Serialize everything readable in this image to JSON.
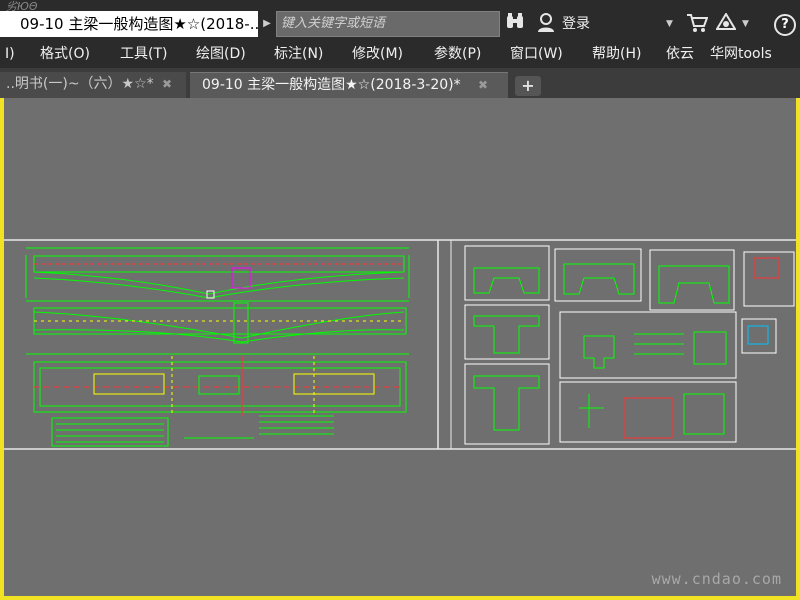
{
  "titlebar": {
    "app_glyph": "劣ЮΘ",
    "document_title": "09-10 主梁一般构造图★☆(2018-...",
    "search_placeholder": "键入关键字或短语",
    "login_label": "登录",
    "help_label": "?",
    "icons": [
      "binoculars-icon",
      "user-icon",
      "cart-icon",
      "a360-icon",
      "help-icon"
    ]
  },
  "menu": {
    "items": [
      {
        "label": "I)"
      },
      {
        "label": "格式(O)"
      },
      {
        "label": "工具(T)"
      },
      {
        "label": "绘图(D)"
      },
      {
        "label": "标注(N)"
      },
      {
        "label": "修改(M)"
      },
      {
        "label": "参数(P)"
      },
      {
        "label": "窗口(W)"
      },
      {
        "label": "帮助(H)"
      },
      {
        "label": "依云"
      },
      {
        "label": "华网tools"
      }
    ]
  },
  "tabs": [
    {
      "label": "..明书(一)~（六）★☆*",
      "active": false
    },
    {
      "label": "09-10 主梁一般构造图★☆(2018-3-20)*",
      "active": true
    }
  ],
  "tab_close_glyph": "✖",
  "tab_add_glyph": "+",
  "watermark": "www.cndao.com",
  "colors": {
    "frame": "#f2e224",
    "chrome": "#2b2b2b",
    "canvas": "#6f6f6f",
    "drawing_line": "#00ff00",
    "accent_red": "#ff3030",
    "accent_magenta": "#ff00ff",
    "accent_yellow": "#ffff00"
  }
}
